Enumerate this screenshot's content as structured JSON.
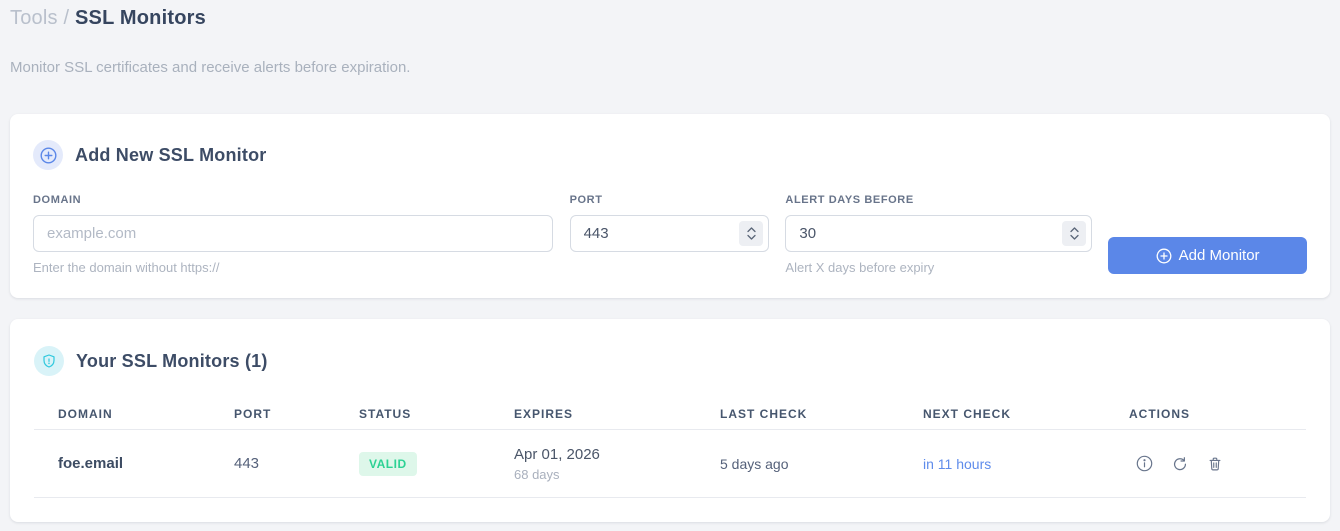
{
  "breadcrumb": {
    "section": "Tools",
    "separator": "/",
    "page": "SSL Monitors"
  },
  "subtitle": "Monitor SSL certificates and receive alerts before expiration.",
  "add_form": {
    "title": "Add New SSL Monitor",
    "fields": {
      "domain": {
        "label": "DOMAIN",
        "placeholder": "example.com",
        "value": "",
        "helper": "Enter the domain without https://"
      },
      "port": {
        "label": "PORT",
        "value": "443"
      },
      "alert_days": {
        "label": "ALERT DAYS BEFORE",
        "value": "30",
        "helper": "Alert X days before expiry"
      }
    },
    "submit_label": "Add Monitor"
  },
  "monitors": {
    "title": "Your SSL Monitors (1)",
    "count": "1",
    "table": {
      "headers": [
        "DOMAIN",
        "PORT",
        "STATUS",
        "EXPIRES",
        "LAST CHECK",
        "NEXT CHECK",
        "ACTIONS"
      ],
      "rows": [
        {
          "domain": "foe.email",
          "port": "443",
          "status": "VALID",
          "expires_date": "Apr 01, 2026",
          "expires_days": "68 days",
          "last_check": "5 days ago",
          "next_check": "in 11 hours"
        }
      ]
    }
  },
  "icons": {
    "add_section": "circle-plus-icon",
    "monitors_section": "shield-icon",
    "submit": "circle-plus-icon",
    "row_actions": [
      "info-icon",
      "refresh-icon",
      "trash-icon"
    ]
  },
  "colors": {
    "accent_blue": "#5b87e8",
    "accent_cyan": "#2ec8dd",
    "valid_green": "#2cd294",
    "valid_green_bg": "#def7ea",
    "page_bg": "#f3f4f7",
    "card_bg": "#ffffff",
    "heading": "#36455f",
    "muted": "#a9b1bd"
  }
}
